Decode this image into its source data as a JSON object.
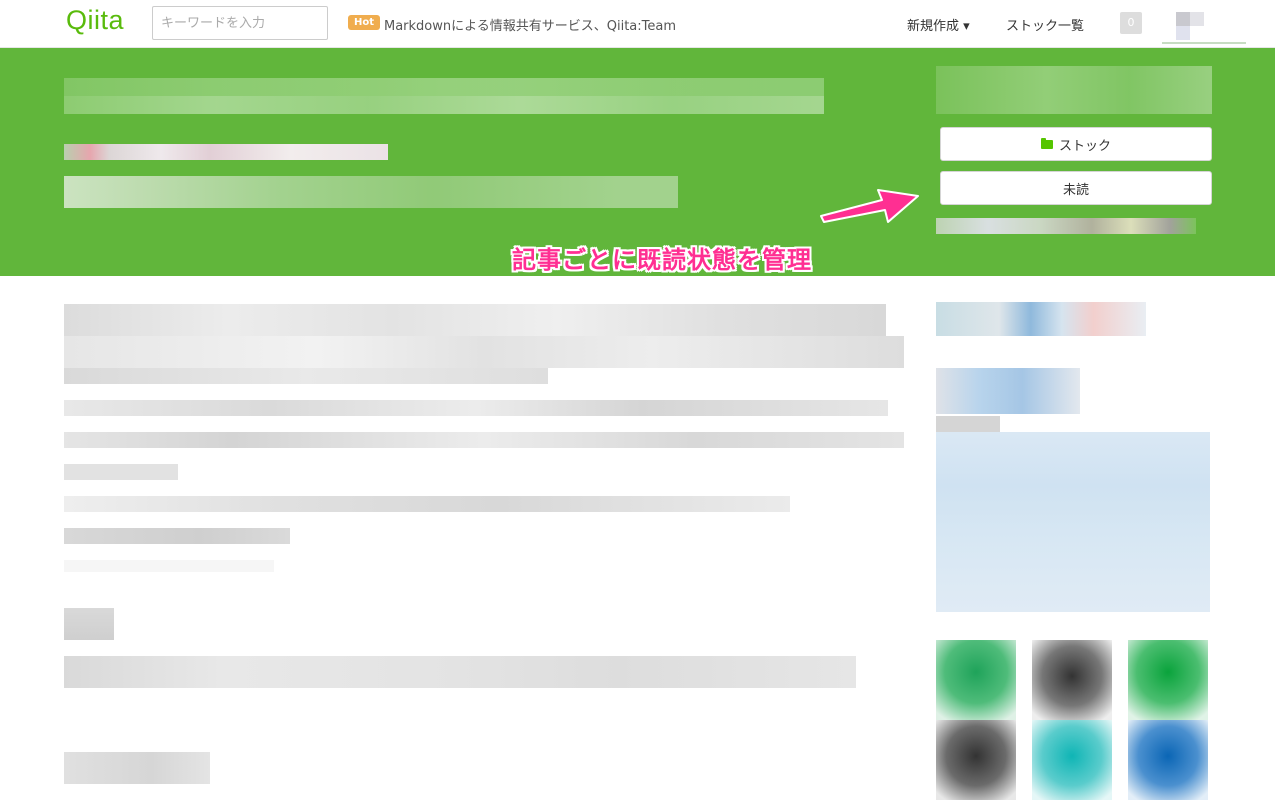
{
  "header": {
    "logo": "Qiita",
    "search_placeholder": "キーワードを入力",
    "hot_badge": "Hot",
    "hot_text": "Markdownによる情報共有サービス、Qiita:Team",
    "nav_new": "新規作成 ▾",
    "nav_stock_list": "ストック一覧",
    "notification_count": "0"
  },
  "banner": {
    "stock_button": "ストック",
    "unread_button": "未読",
    "annotation": "記事ごとに既読状態を管理",
    "color": "#61b63b"
  },
  "colors": {
    "brand": "#59bb0c",
    "annotation": "#ff2f92",
    "hot": "#f0ad4e"
  },
  "icons": [
    "folder-icon",
    "arrow-icon",
    "avatar"
  ]
}
